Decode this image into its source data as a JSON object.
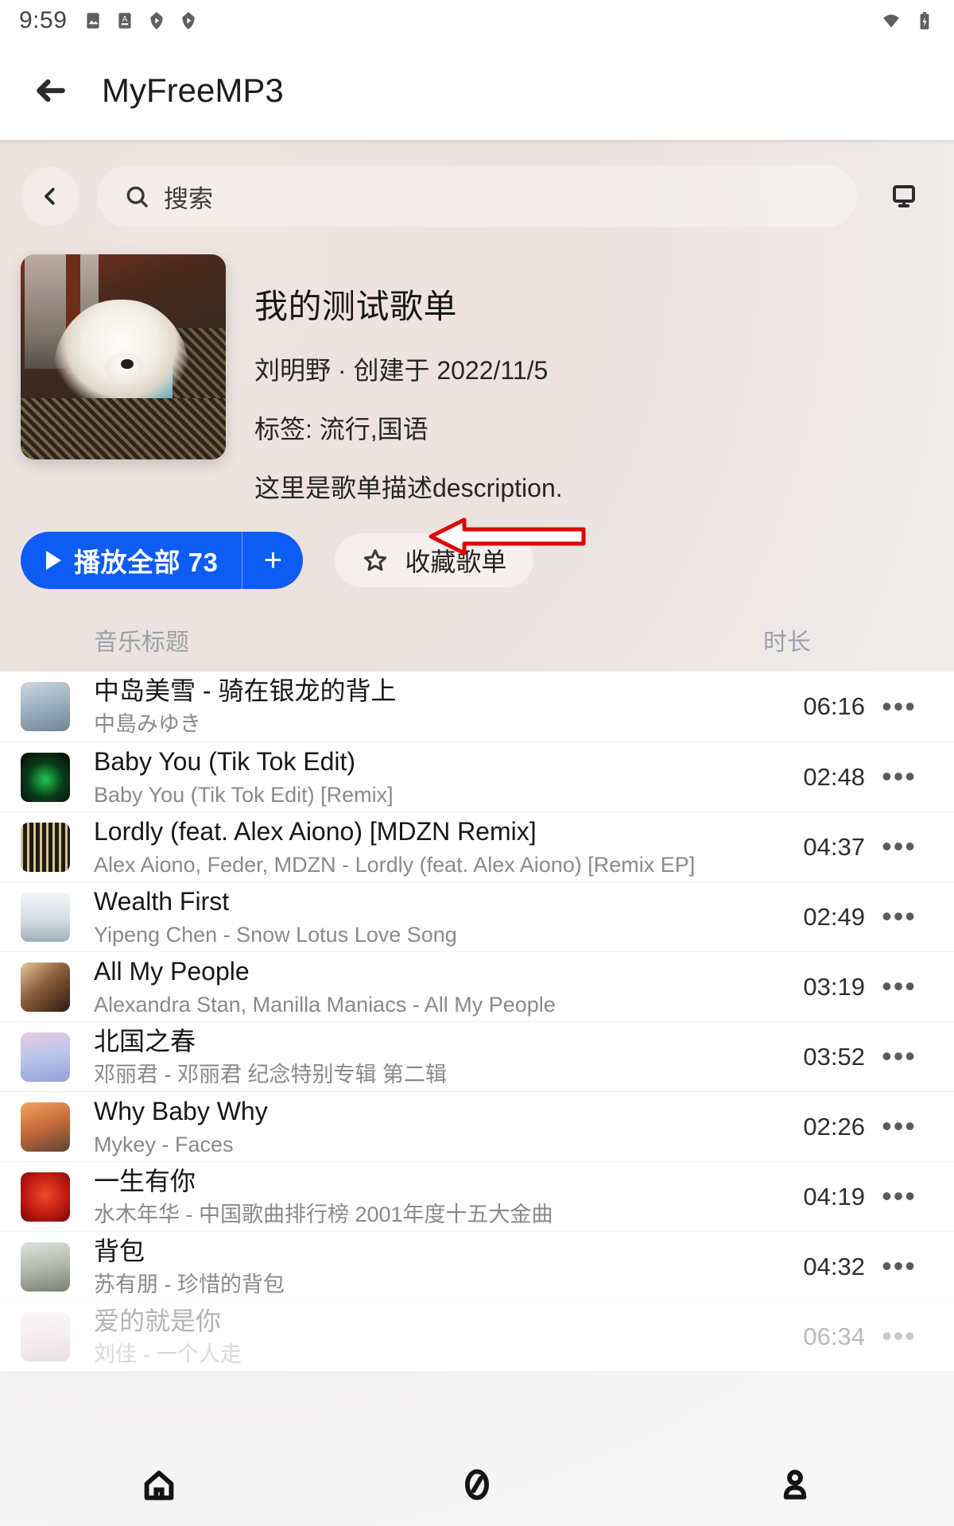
{
  "statusbar": {
    "time": "9:59",
    "left_icons": [
      "image-icon",
      "app-a-icon",
      "play-shield-icon",
      "play-shield-icon-2"
    ],
    "right_icons": [
      "wifi-icon",
      "battery-charging-icon"
    ]
  },
  "appbar": {
    "back_icon": "arrow-left-icon",
    "title": "MyFreeMP3"
  },
  "search": {
    "back_icon": "chevron-left-icon",
    "search_icon": "search-icon",
    "placeholder": "搜索",
    "cast_icon": "cast-screen-icon"
  },
  "playlist": {
    "cover_alt": "playlist-cover-dog-photo",
    "title": "我的测试歌单",
    "subtitle": "刘明野 · 创建于 2022/11/5",
    "tags": "标签: 流行,国语",
    "description": "这里是歌单描述description.",
    "accent_color": "#0d5cf5"
  },
  "actions": {
    "play_icon": "play-triangle-icon",
    "play_label": "播放全部 73",
    "play_count": "73",
    "add_icon": "plus-icon",
    "add_label": "+",
    "fav_icon": "star-outline-icon",
    "fav_label": "收藏歌单",
    "annotation": "red-arrow-pointing-to-favorite-button"
  },
  "table": {
    "col_title": "音乐标题",
    "col_duration": "时长",
    "more_icon": "more-horizontal-icon"
  },
  "songs": [
    {
      "title": "中岛美雪 - 骑在银龙的背上",
      "subtitle": "中島みゆき",
      "duration": "06:16",
      "thumb": "portrait-woman-blue",
      "faded": false
    },
    {
      "title": "Baby You (Tik Tok Edit)",
      "subtitle": "Baby You (Tik Tok Edit) [Remix]",
      "duration": "02:48",
      "thumb": "neon-green-black",
      "faded": false
    },
    {
      "title": "Lordly (feat. Alex Aiono) [MDZN Remix]",
      "subtitle": "Alex Aiono, Feder, MDZN - Lordly (feat. Alex Aiono) [Remix EP]",
      "duration": "04:37",
      "thumb": "dark-text-bars",
      "faded": false
    },
    {
      "title": "Wealth First",
      "subtitle": "Yipeng Chen - Snow Lotus Love Song",
      "duration": "02:49",
      "thumb": "snow-mountain-white",
      "faded": false
    },
    {
      "title": "All My People",
      "subtitle": "Alexandra Stan, Manilla Maniacs - All My People",
      "duration": "03:19",
      "thumb": "collage-warm",
      "faded": false
    },
    {
      "title": "北国之春",
      "subtitle": "邓丽君 - 邓丽君 纪念特别专辑 第二辑",
      "duration": "03:52",
      "thumb": "lavender-portrait",
      "faded": false
    },
    {
      "title": "Why Baby Why",
      "subtitle": "Mykey - Faces",
      "duration": "02:26",
      "thumb": "orange-portrait",
      "faded": false
    },
    {
      "title": "一生有你",
      "subtitle": "水木年华 - 中国歌曲排行榜 2001年度十五大金曲",
      "duration": "04:19",
      "thumb": "red-album",
      "faded": false
    },
    {
      "title": "背包",
      "subtitle": "苏有朋 - 珍惜的背包",
      "duration": "04:32",
      "thumb": "street-portrait",
      "faded": false
    },
    {
      "title": "爱的就是你",
      "subtitle": "刘佳 - 一个人走",
      "duration": "06:34",
      "thumb": "pale-pink-portrait",
      "faded": true
    }
  ],
  "bottomnav": {
    "items": [
      {
        "icon": "home-icon",
        "name": "home"
      },
      {
        "icon": "compass-icon",
        "name": "discover"
      },
      {
        "icon": "person-icon",
        "name": "profile"
      }
    ]
  }
}
